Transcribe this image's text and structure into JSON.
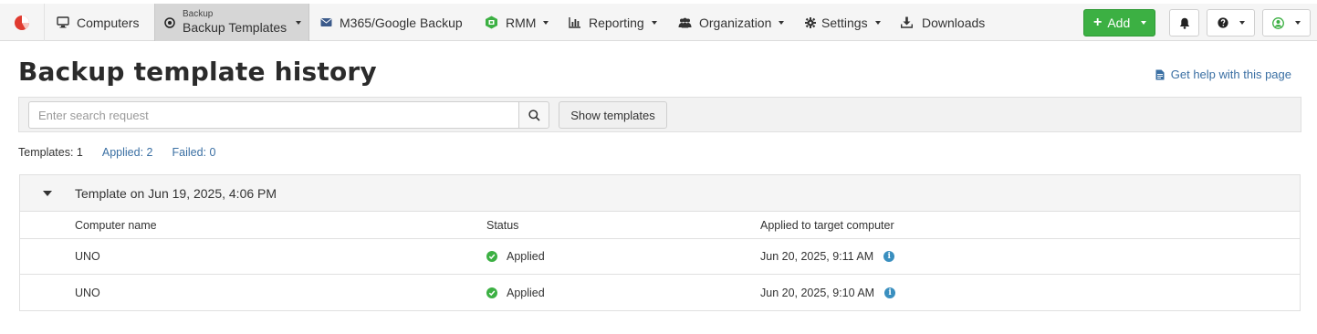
{
  "nav": {
    "items": [
      {
        "label": "Computers",
        "icon": "monitor-icon"
      },
      {
        "small_label": "Backup",
        "label": "Backup Templates",
        "icon": "play-circle-icon",
        "active": true
      },
      {
        "label": "M365/Google Backup",
        "icon": "envelope-icon"
      },
      {
        "label": "RMM",
        "icon": "rmm-shield-icon"
      },
      {
        "label": "Reporting",
        "icon": "bar-chart-icon"
      },
      {
        "label": "Organization",
        "icon": "users-icon"
      },
      {
        "label": "Settings",
        "icon": "gear-icon"
      },
      {
        "label": "Downloads",
        "icon": "download-icon"
      }
    ],
    "add_label": "Add"
  },
  "page": {
    "title": "Backup template history",
    "help_link": "Get help with this page"
  },
  "search": {
    "placeholder": "Enter search request",
    "value": "",
    "show_templates_label": "Show templates"
  },
  "stats": {
    "templates": "Templates: 1",
    "applied": "Applied: 2",
    "failed": "Failed: 0"
  },
  "group": {
    "title": "Template on Jun 19, 2025, 4:06 PM",
    "columns": [
      "Computer name",
      "Status",
      "Applied to target computer"
    ],
    "rows": [
      {
        "computer": "UNO",
        "status": "Applied",
        "applied_at": "Jun 20, 2025, 9:11 AM"
      },
      {
        "computer": "UNO",
        "status": "Applied",
        "applied_at": "Jun 20, 2025, 9:10 AM"
      }
    ]
  },
  "colors": {
    "accent_green": "#3cb043",
    "link_blue": "#3a6fa3",
    "logo_red": "#e03a2f",
    "info_blue": "#3a8fbf"
  }
}
